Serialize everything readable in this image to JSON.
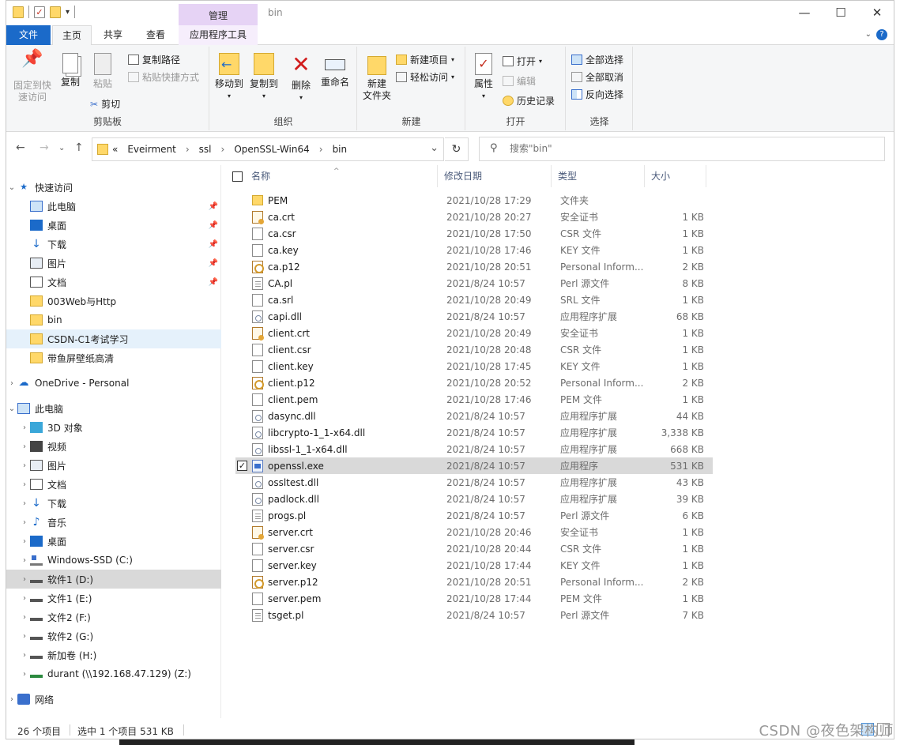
{
  "window": {
    "title": "bin",
    "context_tab_group": "管理",
    "controls": {
      "minimize": "—",
      "maximize": "☐",
      "close": "✕"
    }
  },
  "tabs": [
    {
      "label": "文件"
    },
    {
      "label": "主页"
    },
    {
      "label": "共享"
    },
    {
      "label": "查看"
    },
    {
      "label": "应用程序工具"
    }
  ],
  "ribbon": {
    "clipboard": {
      "label": "剪贴板",
      "pin": "固定到快\n速访问",
      "copy": "复制",
      "paste": "粘贴",
      "copy_path": "复制路径",
      "paste_shortcut": "粘贴快捷方式",
      "cut": "剪切"
    },
    "organize": {
      "label": "组织",
      "move_to": "移动到",
      "copy_to": "复制到",
      "delete": "删除",
      "rename": "重命名"
    },
    "new": {
      "label": "新建",
      "new_folder": "新建\n文件夹",
      "new_item": "新建项目",
      "easy_access": "轻松访问"
    },
    "open": {
      "label": "打开",
      "properties": "属性",
      "open": "打开",
      "edit": "编辑",
      "history": "历史记录"
    },
    "select": {
      "label": "选择",
      "select_all": "全部选择",
      "select_none": "全部取消",
      "invert": "反向选择"
    }
  },
  "address": {
    "crumbs": [
      "«",
      "Eveirment",
      "›",
      "ssl",
      "›",
      "OpenSSL-Win64",
      "›",
      "bin"
    ],
    "dropdown": "⌄",
    "refresh": "↻",
    "search_placeholder": "搜索\"bin\""
  },
  "nav": {
    "quick_access": "快速访问",
    "quick_items": [
      {
        "label": "此电脑",
        "pinned": true
      },
      {
        "label": "桌面",
        "pinned": true
      },
      {
        "label": "下载",
        "pinned": true
      },
      {
        "label": "图片",
        "pinned": true
      },
      {
        "label": "文档",
        "pinned": true
      },
      {
        "label": "003Web与Http"
      },
      {
        "label": "bin"
      },
      {
        "label": "CSDN-C1考试学习"
      },
      {
        "label": "带鱼屏壁纸高清"
      }
    ],
    "onedrive": "OneDrive - Personal",
    "this_pc": "此电脑",
    "pc_items": [
      {
        "label": "3D 对象"
      },
      {
        "label": "视频"
      },
      {
        "label": "图片"
      },
      {
        "label": "文档"
      },
      {
        "label": "下载"
      },
      {
        "label": "音乐"
      },
      {
        "label": "桌面"
      },
      {
        "label": "Windows-SSD (C:)"
      },
      {
        "label": "软件1 (D:)"
      },
      {
        "label": "文件1 (E:)"
      },
      {
        "label": "文件2 (F:)"
      },
      {
        "label": "软件2 (G:)"
      },
      {
        "label": "新加卷 (H:)"
      },
      {
        "label": "durant (\\\\192.168.47.129) (Z:)"
      }
    ],
    "network": "网络"
  },
  "columns": {
    "name": "名称",
    "date": "修改日期",
    "type": "类型",
    "size": "大小"
  },
  "files": [
    {
      "name": "PEM",
      "date": "2021/10/28 17:29",
      "type": "文件夹",
      "size": "",
      "icon": "folder"
    },
    {
      "name": "ca.crt",
      "date": "2021/10/28 20:27",
      "type": "安全证书",
      "size": "1 KB",
      "icon": "cert"
    },
    {
      "name": "ca.csr",
      "date": "2021/10/28 17:50",
      "type": "CSR 文件",
      "size": "1 KB",
      "icon": "file"
    },
    {
      "name": "ca.key",
      "date": "2021/10/28 17:46",
      "type": "KEY 文件",
      "size": "1 KB",
      "icon": "file"
    },
    {
      "name": "ca.p12",
      "date": "2021/10/28 20:51",
      "type": "Personal Inform...",
      "size": "2 KB",
      "icon": "pfx"
    },
    {
      "name": "CA.pl",
      "date": "2021/8/24 10:57",
      "type": "Perl 源文件",
      "size": "8 KB",
      "icon": "pl"
    },
    {
      "name": "ca.srl",
      "date": "2021/10/28 20:49",
      "type": "SRL 文件",
      "size": "1 KB",
      "icon": "file"
    },
    {
      "name": "capi.dll",
      "date": "2021/8/24 10:57",
      "type": "应用程序扩展",
      "size": "68 KB",
      "icon": "dll"
    },
    {
      "name": "client.crt",
      "date": "2021/10/28 20:49",
      "type": "安全证书",
      "size": "1 KB",
      "icon": "cert"
    },
    {
      "name": "client.csr",
      "date": "2021/10/28 20:48",
      "type": "CSR 文件",
      "size": "1 KB",
      "icon": "file"
    },
    {
      "name": "client.key",
      "date": "2021/10/28 17:45",
      "type": "KEY 文件",
      "size": "1 KB",
      "icon": "file"
    },
    {
      "name": "client.p12",
      "date": "2021/10/28 20:52",
      "type": "Personal Inform...",
      "size": "2 KB",
      "icon": "pfx"
    },
    {
      "name": "client.pem",
      "date": "2021/10/28 17:46",
      "type": "PEM 文件",
      "size": "1 KB",
      "icon": "file"
    },
    {
      "name": "dasync.dll",
      "date": "2021/8/24 10:57",
      "type": "应用程序扩展",
      "size": "44 KB",
      "icon": "dll"
    },
    {
      "name": "libcrypto-1_1-x64.dll",
      "date": "2021/8/24 10:57",
      "type": "应用程序扩展",
      "size": "3,338 KB",
      "icon": "dll"
    },
    {
      "name": "libssl-1_1-x64.dll",
      "date": "2021/8/24 10:57",
      "type": "应用程序扩展",
      "size": "668 KB",
      "icon": "dll"
    },
    {
      "name": "openssl.exe",
      "date": "2021/8/24 10:57",
      "type": "应用程序",
      "size": "531 KB",
      "icon": "exe",
      "selected": true
    },
    {
      "name": "ossltest.dll",
      "date": "2021/8/24 10:57",
      "type": "应用程序扩展",
      "size": "43 KB",
      "icon": "dll"
    },
    {
      "name": "padlock.dll",
      "date": "2021/8/24 10:57",
      "type": "应用程序扩展",
      "size": "39 KB",
      "icon": "dll"
    },
    {
      "name": "progs.pl",
      "date": "2021/8/24 10:57",
      "type": "Perl 源文件",
      "size": "6 KB",
      "icon": "pl"
    },
    {
      "name": "server.crt",
      "date": "2021/10/28 20:46",
      "type": "安全证书",
      "size": "1 KB",
      "icon": "cert"
    },
    {
      "name": "server.csr",
      "date": "2021/10/28 20:44",
      "type": "CSR 文件",
      "size": "1 KB",
      "icon": "file"
    },
    {
      "name": "server.key",
      "date": "2021/10/28 17:44",
      "type": "KEY 文件",
      "size": "1 KB",
      "icon": "file"
    },
    {
      "name": "server.p12",
      "date": "2021/10/28 20:51",
      "type": "Personal Inform...",
      "size": "2 KB",
      "icon": "pfx"
    },
    {
      "name": "server.pem",
      "date": "2021/10/28 17:44",
      "type": "PEM 文件",
      "size": "1 KB",
      "icon": "file"
    },
    {
      "name": "tsget.pl",
      "date": "2021/8/24 10:57",
      "type": "Perl 源文件",
      "size": "7 KB",
      "icon": "pl"
    }
  ],
  "status": {
    "count": "26 个项目",
    "selected": "选中 1 个项目  531 KB"
  },
  "watermark": "CSDN @夜色架构师"
}
